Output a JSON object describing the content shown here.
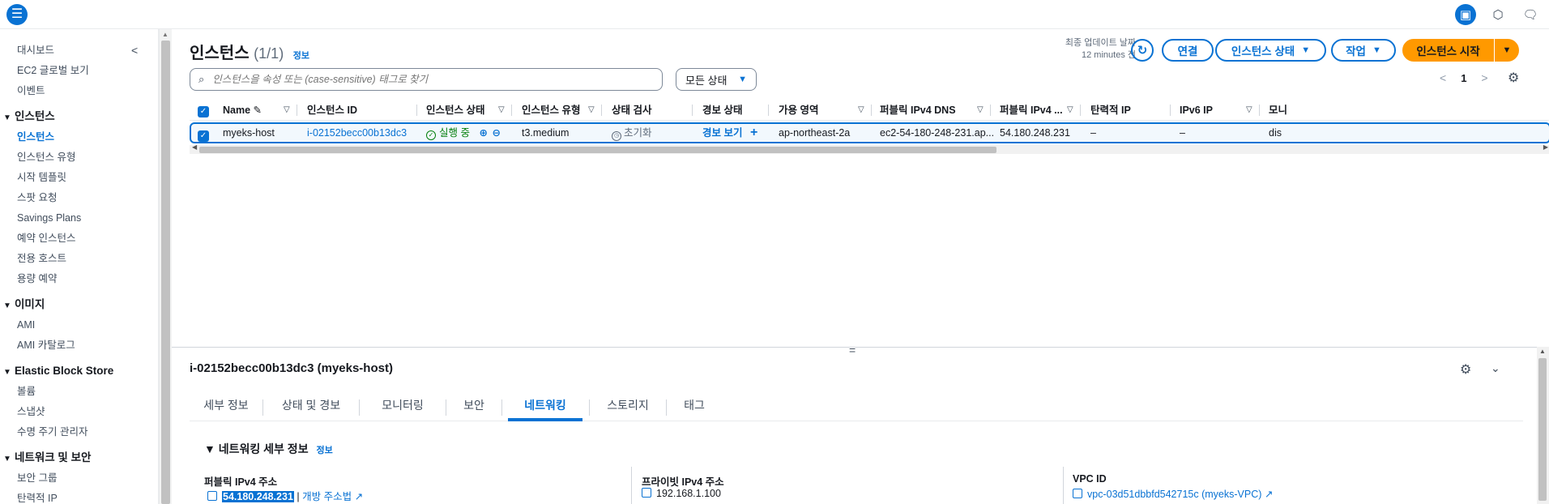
{
  "topbar": {
    "menu_icon": "hamburger-icon",
    "icons": [
      "panel-icon",
      "settings-hex-icon",
      "feedback-icon"
    ]
  },
  "sidebar": {
    "collapse_icon": "chevron-left-icon",
    "top_items": [
      "대시보드",
      "EC2 글로벌 보기",
      "이벤트"
    ],
    "sections": [
      {
        "title": "인스턴스",
        "items": [
          "인스턴스",
          "인스턴스 유형",
          "시작 템플릿",
          "스팟 요청",
          "Savings Plans",
          "예약 인스턴스",
          "전용 호스트",
          "용량 예약"
        ]
      },
      {
        "title": "이미지",
        "items": [
          "AMI",
          "AMI 카탈로그"
        ]
      },
      {
        "title": "Elastic Block Store",
        "items": [
          "볼륨",
          "스냅샷",
          "수명 주기 관리자"
        ]
      },
      {
        "title": "네트워크 및 보안",
        "items": [
          "보안 그룹",
          "탄력적 IP"
        ]
      }
    ]
  },
  "header": {
    "title": "인스턴스",
    "count": "(1/1)",
    "info": "정보",
    "last_updated_label": "최종 업데이트 날짜",
    "last_updated_value": "12 minutes 전",
    "connect": "연결",
    "instance_state": "인스턴스 상태",
    "actions": "작업",
    "launch": "인스턴스 시작"
  },
  "filter": {
    "search_placeholder": "인스턴스을 속성 또는 (case-sensitive) 태그로 찾기",
    "state_select": "모든 상태"
  },
  "pagination": {
    "current": "1"
  },
  "table": {
    "columns": [
      "Name",
      "인스턴스 ID",
      "인스턴스 상태",
      "인스턴스 유형",
      "상태 검사",
      "경보 상태",
      "가용 영역",
      "퍼블릭 IPv4 DNS",
      "퍼블릭 IPv4 ...",
      "탄력적 IP",
      "IPv6 IP",
      "모니"
    ],
    "row": {
      "name": "myeks-host",
      "instance_id": "i-02152becc00b13dc3",
      "state": "실행 중",
      "type": "t3.medium",
      "status_check": "초기화",
      "alarm": "경보 보기",
      "az": "ap-northeast-2a",
      "public_dns": "ec2-54-180-248-231.ap...",
      "public_ip": "54.180.248.231",
      "elastic_ip": "–",
      "ipv6": "–",
      "monitoring": "dis"
    }
  },
  "detail": {
    "title": "i-02152becc00b13dc3 (myeks-host)",
    "tabs": [
      "세부 정보",
      "상태 및 경보",
      "모니터링",
      "보안",
      "네트워킹",
      "스토리지",
      "태그"
    ],
    "active_tab": "네트워킹",
    "section_title": "네트워킹 세부 정보",
    "section_info": "정보",
    "fields": {
      "public_ipv4_label": "퍼블릭 IPv4 주소",
      "public_ipv4_value": "54.180.248.231",
      "open_address": "개방 주소법",
      "private_ipv4_label": "프라이빗 IPv4 주소",
      "private_ipv4_value": "192.168.1.100",
      "vpc_label": "VPC ID",
      "vpc_value": "vpc-03d51dbbfd542715c (myeks-VPC)"
    }
  },
  "colors": {
    "accent": "#0972d3",
    "launch": "#ff9900",
    "success": "#037f0c"
  }
}
